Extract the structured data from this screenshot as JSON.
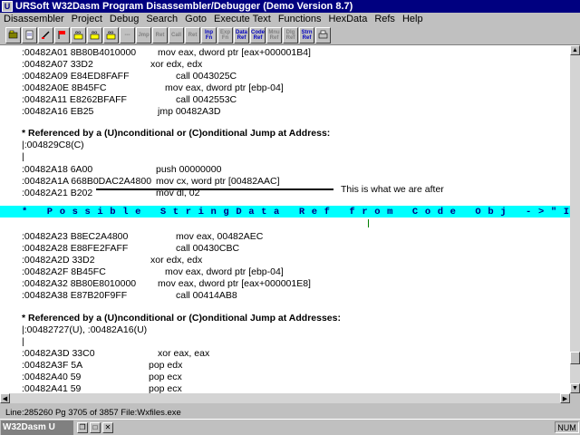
{
  "window": {
    "title": "URSoft W32Dasm Program Disassembler/Debugger (Demo Version 8.7)"
  },
  "menu": [
    "Disassembler",
    "Project",
    "Debug",
    "Search",
    "Goto",
    "Execute Text",
    "Functions",
    "HexData",
    "Refs",
    "Help"
  ],
  "toolbar": {
    "labels": [
      "Inp Fn",
      "Exp Fn",
      "Data Ref",
      "Code Ref",
      "Mnu Ref",
      "Dlg Ref",
      "Strn Ref"
    ]
  },
  "code": {
    "lines1": [
      {
        "addr": ":00482A01 8B80B4010000",
        "instr": "mov eax, dword ptr [eax+000001B4]"
      },
      {
        "addr": ":00482A07 33D2",
        "instr": "xor edx, edx"
      },
      {
        "addr": ":00482A09 E84ED8FAFF",
        "instr": "call 0043025C"
      },
      {
        "addr": ":00482A0E 8B45FC",
        "instr": "mov eax, dword ptr [ebp-04]"
      },
      {
        "addr": ":00482A11 E8262BFAFF",
        "instr": "call 0042553C"
      },
      {
        "addr": ":00482A16 EB25",
        "instr": "jmp 00482A3D"
      }
    ],
    "ref1_header": "* Referenced by a (U)nconditional or (C)onditional Jump at Address:",
    "ref1_addr": "|:004829C8(C)",
    "annotation": "This is what we are after",
    "pipe": "|",
    "lines2": [
      {
        "addr": ":00482A18 6A00",
        "instr": "push 00000000"
      },
      {
        "addr": ":00482A1A 668B0DAC2A4800",
        "instr": "mov cx, word ptr [00482AAC]"
      },
      {
        "addr": ":00482A21 B202",
        "instr": "mov dl, 02"
      }
    ],
    "highlight": "* Possible StringData Ref from Code Obj ->\"Invalid Regi",
    "lines3": [
      {
        "addr": ":00482A23 B8EC2A4800",
        "instr": "mov eax, 00482AEC"
      },
      {
        "addr": ":00482A28 E88FE2FAFF",
        "instr": "call 00430CBC"
      },
      {
        "addr": ":00482A2D 33D2",
        "instr": "xor edx, edx"
      },
      {
        "addr": ":00482A2F 8B45FC",
        "instr": "mov eax, dword ptr [ebp-04]"
      },
      {
        "addr": ":00482A32 8B80E8010000",
        "instr": "mov eax, dword ptr [eax+000001E8]"
      },
      {
        "addr": ":00482A38 E87B20F9FF",
        "instr": "call 00414AB8"
      }
    ],
    "ref2_header": "* Referenced by a (U)nconditional or (C)onditional Jump at Addresses:",
    "ref2_addr": "|:00482727(U), :00482A16(U)",
    "lines4": [
      {
        "addr": ":00482A3D 33C0",
        "instr": "xor eax, eax"
      },
      {
        "addr": ":00482A3F 5A",
        "instr": "pop edx"
      },
      {
        "addr": ":00482A40 59",
        "instr": "pop ecx"
      },
      {
        "addr": ":00482A41 59",
        "instr": "pop ecx"
      }
    ]
  },
  "status": {
    "text": "Line:285260 Pg 3705 of 3857 File:Wxfiles.exe"
  },
  "taskbar": {
    "title": "W32Dasm U",
    "num": "NUM"
  }
}
